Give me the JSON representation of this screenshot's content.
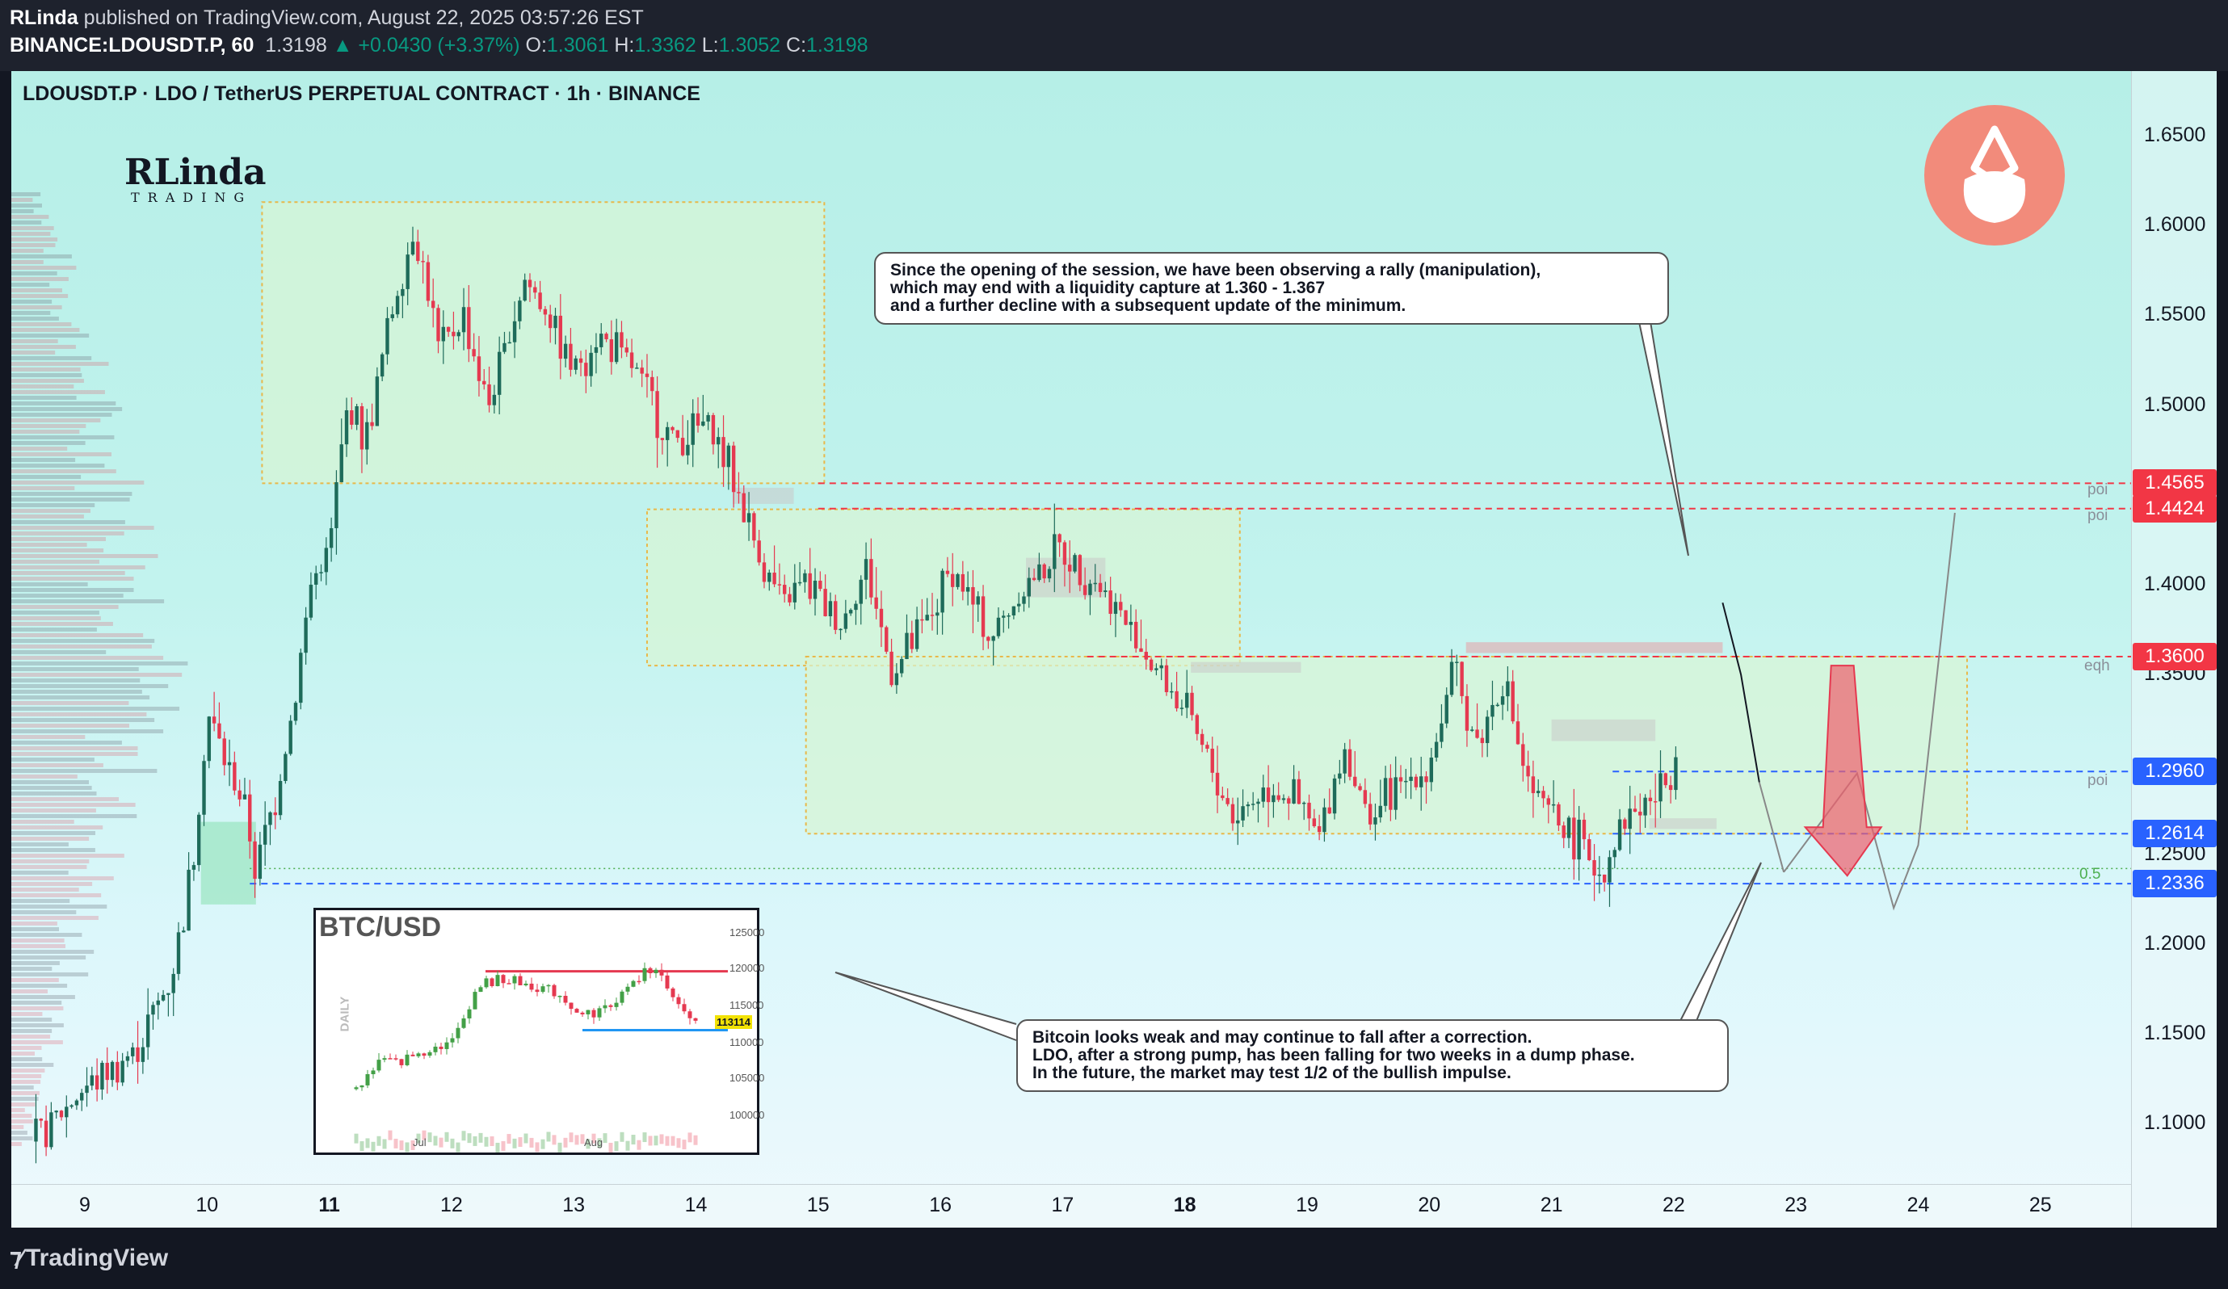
{
  "header": {
    "publisher": "RLinda",
    "published_text": "published on TradingView.com, August 22, 2025 03:57:26 EST",
    "symbol": "BINANCE:LDOUSDT.P, 60",
    "last": "1.3198",
    "change": "▲ +0.0430 (+3.37%)",
    "o_label": "O:",
    "o": "1.3061",
    "h_label": "H:",
    "h": "1.3362",
    "l_label": "L:",
    "l": "1.3052",
    "c_label": "C:",
    "c": "1.3198"
  },
  "chart_title": "LDOUSDT.P · LDO / TetherUS PERPETUAL CONTRACT · 1h · BINANCE",
  "logo": {
    "name": "RLinda",
    "sub": "TRADING"
  },
  "callouts": {
    "top": [
      "Since the opening of the session, we have been observing a rally (manipulation),",
      "which may end with a liquidity capture at 1.360 - 1.367",
      "and a further decline with a subsequent update of the minimum."
    ],
    "bottom": [
      "Bitcoin looks weak and may continue to fall after a correction.",
      "LDO, after a strong pump, has been falling for two weeks in a dump phase.",
      "In the future, the market may test 1/2 of the bullish impulse."
    ]
  },
  "level_labels": {
    "poi1": "poi",
    "poi2": "poi",
    "eqh": "eqh",
    "poi3": "poi",
    "half": "0.5"
  },
  "btc_inset": {
    "title": "BTC/USD",
    "timeframe": "DAILY",
    "price_ticks": [
      "125000",
      "120000",
      "115000",
      "110000",
      "105000",
      "100000"
    ],
    "time_ticks": [
      "Jul",
      "Aug"
    ],
    "last_price": "113114"
  },
  "bottom_bar": {
    "brand": "TradingView"
  },
  "colors": {
    "up": "#089981",
    "candle_up": "#1e6b5a",
    "candle_down": "#e53950",
    "red_level": "#f23645",
    "blue_level": "#2962ff",
    "zone_fill": "#d8f5d4",
    "zone_border": "#e8b84a"
  },
  "chart_data": {
    "type": "candlestick",
    "symbol": "LDOUSDT.P",
    "timeframe": "1h",
    "x_ticks": [
      "9",
      "10",
      "11",
      "12",
      "13",
      "14",
      "15",
      "16",
      "17",
      "18",
      "19",
      "20",
      "21",
      "22",
      "23",
      "24",
      "25"
    ],
    "x_ticks_bold": [
      "11",
      "18"
    ],
    "y_ticks": [
      "1.6500",
      "1.6000",
      "1.5500",
      "1.5000",
      "1.4000",
      "1.3500",
      "1.2500",
      "1.2000",
      "1.1500",
      "1.1000"
    ],
    "ylim": [
      1.07,
      1.68
    ],
    "price_tags": [
      {
        "label": "1.4565",
        "value": 1.4565,
        "color": "#f23645"
      },
      {
        "label": "1.4424",
        "value": 1.4424,
        "color": "#f23645"
      },
      {
        "label": "1.3600",
        "value": 1.36,
        "color": "#f23645"
      },
      {
        "label": "1.2960",
        "value": 1.296,
        "color": "#2962ff"
      },
      {
        "label": "1.2614",
        "value": 1.2614,
        "color": "#2962ff"
      },
      {
        "label": "1.2336",
        "value": 1.2336,
        "color": "#2962ff"
      }
    ],
    "path": [
      [
        8.6,
        1.09
      ],
      [
        9.0,
        1.12
      ],
      [
        9.4,
        1.14
      ],
      [
        9.7,
        1.18
      ],
      [
        9.9,
        1.25
      ],
      [
        10.0,
        1.33
      ],
      [
        10.15,
        1.3
      ],
      [
        10.3,
        1.28
      ],
      [
        10.4,
        1.24
      ],
      [
        10.55,
        1.28
      ],
      [
        10.7,
        1.33
      ],
      [
        10.85,
        1.4
      ],
      [
        11.0,
        1.42
      ],
      [
        11.15,
        1.5
      ],
      [
        11.3,
        1.48
      ],
      [
        11.5,
        1.55
      ],
      [
        11.7,
        1.6
      ],
      [
        11.9,
        1.53
      ],
      [
        12.1,
        1.55
      ],
      [
        12.3,
        1.5
      ],
      [
        12.6,
        1.57
      ],
      [
        12.8,
        1.55
      ],
      [
        13.0,
        1.52
      ],
      [
        13.2,
        1.54
      ],
      [
        13.5,
        1.52
      ],
      [
        13.8,
        1.48
      ],
      [
        14.1,
        1.49
      ],
      [
        14.3,
        1.46
      ],
      [
        14.5,
        1.42
      ],
      [
        14.7,
        1.39
      ],
      [
        14.9,
        1.4
      ],
      [
        15.2,
        1.38
      ],
      [
        15.4,
        1.41
      ],
      [
        15.6,
        1.35
      ],
      [
        15.9,
        1.38
      ],
      [
        16.1,
        1.41
      ],
      [
        16.4,
        1.37
      ],
      [
        16.7,
        1.4
      ],
      [
        17.0,
        1.42
      ],
      [
        17.3,
        1.4
      ],
      [
        17.5,
        1.38
      ],
      [
        17.8,
        1.35
      ],
      [
        18.0,
        1.33
      ],
      [
        18.2,
        1.3
      ],
      [
        18.4,
        1.27
      ],
      [
        18.7,
        1.29
      ],
      [
        18.9,
        1.28
      ],
      [
        19.1,
        1.26
      ],
      [
        19.3,
        1.31
      ],
      [
        19.5,
        1.27
      ],
      [
        19.8,
        1.29
      ],
      [
        20.0,
        1.3
      ],
      [
        20.2,
        1.35
      ],
      [
        20.4,
        1.31
      ],
      [
        20.6,
        1.35
      ],
      [
        20.8,
        1.29
      ],
      [
        21.0,
        1.27
      ],
      [
        21.2,
        1.26
      ],
      [
        21.4,
        1.24
      ],
      [
        21.6,
        1.27
      ],
      [
        21.8,
        1.28
      ],
      [
        21.95,
        1.29
      ],
      [
        22.05,
        1.3198
      ]
    ],
    "zones": [
      {
        "x0": 10.45,
        "x1": 15.05,
        "y0": 1.4565,
        "y1": 1.613
      },
      {
        "x0": 13.6,
        "x1": 18.45,
        "y0": 1.355,
        "y1": 1.442
      },
      {
        "x0": 14.9,
        "x1": 24.4,
        "y0": 1.2614,
        "y1": 1.36
      }
    ],
    "projections": [
      {
        "color": "#131722",
        "points": [
          [
            22.4,
            1.39
          ],
          [
            22.55,
            1.35
          ],
          [
            22.7,
            1.29
          ]
        ]
      },
      {
        "color": "#888888",
        "points": [
          [
            22.7,
            1.29
          ],
          [
            22.9,
            1.24
          ]
        ]
      },
      {
        "color": "#888888",
        "points": [
          [
            22.9,
            1.24
          ],
          [
            23.5,
            1.295
          ],
          [
            23.8,
            1.22
          ],
          [
            24.0,
            1.255
          ],
          [
            24.3,
            1.44
          ]
        ]
      }
    ],
    "half_level": 1.242
  }
}
